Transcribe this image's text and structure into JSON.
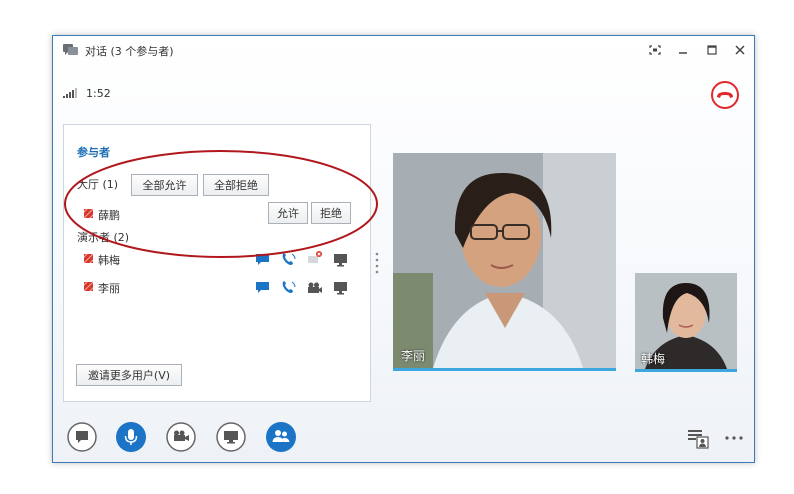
{
  "window": {
    "title": "对话 (3 个参与者)",
    "timer": "1:52"
  },
  "participants_panel": {
    "title": "参与者",
    "lobby": {
      "label": "大厅 (1)",
      "allow_all_label": "全部允许",
      "deny_all_label": "全部拒绝",
      "members": [
        {
          "name": "薛鹏",
          "allow_label": "允许",
          "deny_label": "拒绝"
        }
      ]
    },
    "presenters": {
      "label": "演示者 (2)",
      "members": [
        {
          "name": "韩梅"
        },
        {
          "name": "李丽"
        }
      ]
    },
    "invite_label": "邀请更多用户(V)"
  },
  "video": {
    "main_name": "李丽",
    "small_name": "韩梅"
  },
  "colors": {
    "accent": "#1b6cb5",
    "hangup": "#e0282e",
    "annotation_ellipse": "#b0181e",
    "video_bar": "#3ca7df"
  },
  "icons": [
    "conversation-icon",
    "fullscreen-icon",
    "minimize-icon",
    "maximize-icon",
    "close-icon",
    "signal-icon",
    "hangup-icon",
    "im-icon",
    "mic-icon",
    "video-icon",
    "screen-share-icon",
    "participants-icon",
    "roster-view-icon",
    "more-options-icon"
  ]
}
